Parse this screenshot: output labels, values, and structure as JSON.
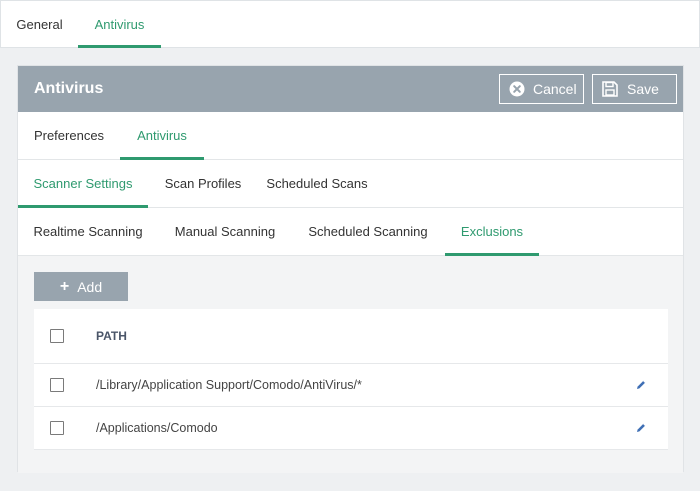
{
  "top_tabs": [
    {
      "label": "General",
      "active": false
    },
    {
      "label": "Antivirus",
      "active": true
    }
  ],
  "panel": {
    "title": "Antivirus",
    "cancel_label": "Cancel",
    "save_label": "Save"
  },
  "level1_tabs": [
    {
      "label": "Preferences",
      "active": false
    },
    {
      "label": "Antivirus",
      "active": true
    }
  ],
  "level2_tabs": [
    {
      "label": "Scanner Settings",
      "active": true
    },
    {
      "label": "Scan Profiles",
      "active": false
    },
    {
      "label": "Scheduled Scans",
      "active": false
    }
  ],
  "level3_tabs": [
    {
      "label": "Realtime Scanning",
      "active": false
    },
    {
      "label": "Manual Scanning",
      "active": false
    },
    {
      "label": "Scheduled Scanning",
      "active": false
    },
    {
      "label": "Exclusions",
      "active": true
    }
  ],
  "exclusions": {
    "add_label": "Add",
    "header_path": "PATH",
    "rows": [
      {
        "path": "/Library/Application Support/Comodo/AntiVirus/*"
      },
      {
        "path": "/Applications/Comodo"
      }
    ]
  },
  "colors": {
    "accent": "#2f9a6f",
    "header_bg": "#98a4ae",
    "edit_icon": "#3f6fb5"
  }
}
